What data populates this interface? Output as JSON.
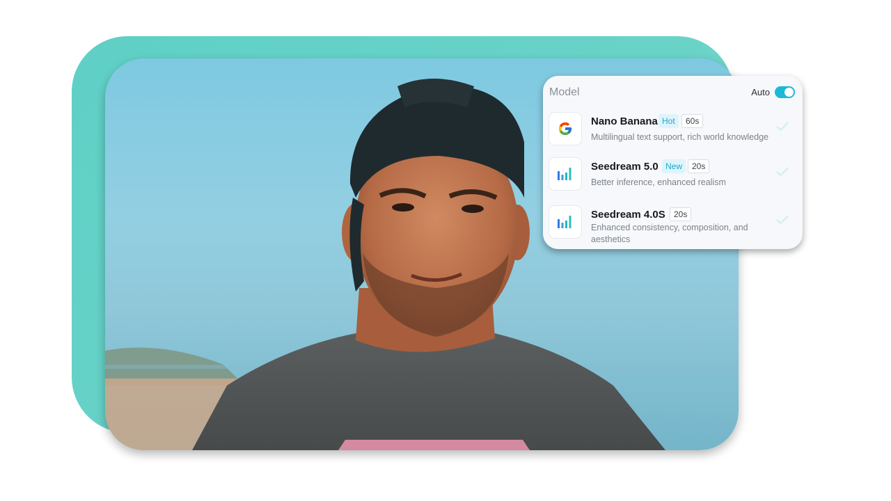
{
  "panel": {
    "title": "Model",
    "auto_label": "Auto",
    "auto_enabled": true,
    "accent_color": "#1bb8d8"
  },
  "models": [
    {
      "name": "Nano Banana",
      "badge": "Hot",
      "time": "60s",
      "description": "Multilingual text support, rich world knowledge",
      "icon": "google-icon"
    },
    {
      "name": "Seedream 5.0",
      "badge": "New",
      "time": "20s",
      "description": "Better inference, enhanced realism",
      "icon": "seedream-bars-icon"
    },
    {
      "name": "Seedream 4.0S",
      "time": "20s",
      "description": "Enhanced consistency, composition, and aesthetics",
      "icon": "seedream-bars-icon"
    }
  ]
}
